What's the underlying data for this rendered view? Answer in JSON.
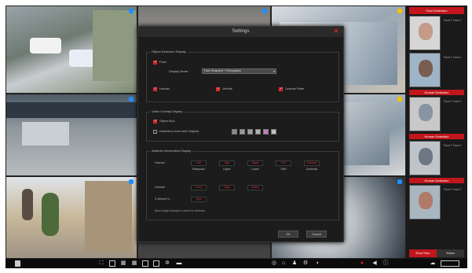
{
  "dialog": {
    "title": "Settings",
    "sections": {
      "object_detection": {
        "title": "Object Detection Display",
        "face_label": "Face",
        "display_mode_label": "Display Mode",
        "display_mode_value": "Face Snapshot + Recognition",
        "human_label": "Human",
        "vehicle_label": "Vehicle",
        "license_plate_label": "License Plate"
      },
      "video_overlay": {
        "title": "Video Overlay Display",
        "object_box_label": "Object Box",
        "detection_lines_label": "Detection Lines and Objects"
      },
      "attribute": {
        "title": "Attribute Information Display",
        "human_label": "Human",
        "human_items": [
          "Hat",
          "Age",
          "Mask",
          "Pet",
          "Glasses"
        ],
        "human_subitems": [
          "Backpack",
          "Upper",
          "Lower",
          "Skirt",
          "Umbrella"
        ],
        "vehicle_label": "Vehicle",
        "vehicle_items": [
          "Color",
          "Type",
          "Brand"
        ],
        "two_wheel_label": "2-Wheel V...",
        "two_wheel_items": [
          "Type"
        ],
        "note": "Back single display to reset the Attribute."
      }
    },
    "ok_label": "OK",
    "cancel_label": "Cancel"
  },
  "side_panel": {
    "header": "Face Detection",
    "subheaders": [
      "Human Detection",
      "Human Detection",
      "Human Detection"
    ],
    "snapshot_info": "Face 1 Face 2",
    "tabs": [
      "Real Time",
      "Status"
    ]
  },
  "colors": {
    "accent": "#c0161c",
    "swatches": [
      "#8a8a8a",
      "#9a9a9a",
      "#a0a0a0",
      "#b0b0b0",
      "#c080c0",
      "#c0c0c0"
    ]
  },
  "icons": {
    "taskbar": [
      "start-icon",
      "layout-1-icon",
      "layout-4-icon",
      "layout-9-icon",
      "layout-16-icon",
      "layout-custom-icon",
      "sequence-icon",
      "more-icon",
      "playback-icon",
      "ptz-icon",
      "alarm-icon",
      "person-icon",
      "network-icon",
      "record-icon",
      "notification-icon",
      "info-icon",
      "system-icon"
    ]
  }
}
